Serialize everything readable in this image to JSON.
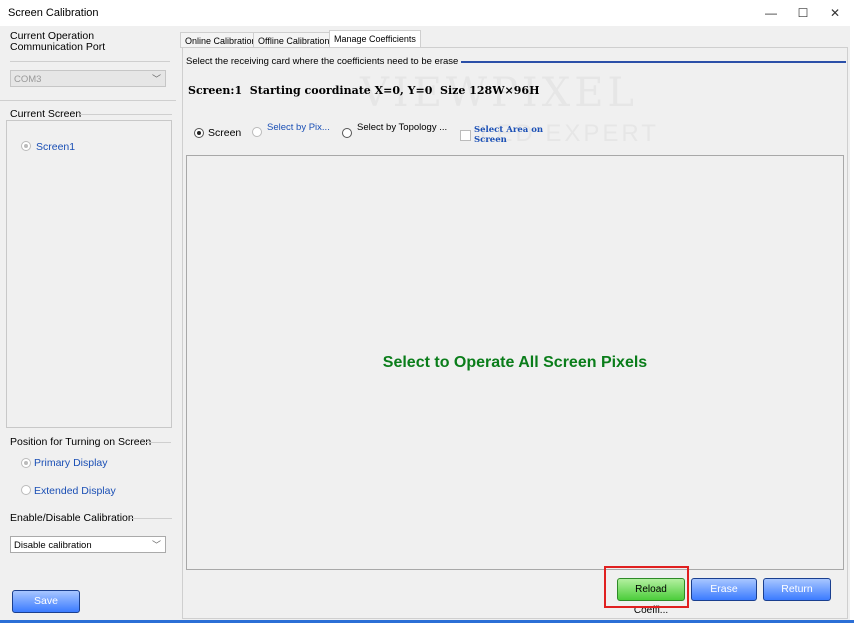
{
  "window": {
    "title": "Screen Calibration",
    "minimize": "—",
    "maximize": "☐",
    "close": "✕"
  },
  "left": {
    "comm_port_label": "Current Operation Communication Port",
    "comm_port_value": "COM3",
    "current_screen_label": "Current Screen",
    "screen_option": "Screen1",
    "position_label": "Position for Turning on Screen",
    "primary_display": "Primary Display",
    "extended_display": "Extended Display",
    "calibration_label": "Enable/Disable Calibration",
    "calibration_value": "Disable calibration",
    "save_button": "Save"
  },
  "tabs": [
    {
      "label": "Online Calibration",
      "active": false
    },
    {
      "label": "Offline Calibration",
      "active": false
    },
    {
      "label": "Manage Coefficients",
      "active": true
    }
  ],
  "main": {
    "instruction": "Select the receiving card where the coefficients need to be erase",
    "screen_info": "Screen:1  Starting coordinate X=0, Y=0  Size 128W×96H",
    "options": {
      "screen": "Screen",
      "select_by_pixel": "Select by Pix...",
      "select_by_topology": "Select by Topology ...",
      "select_area": "Select Area on Screen"
    },
    "area_message": "Select to Operate All Screen Pixels",
    "watermark_top": "VIEWPIXEL",
    "watermark_bottom": "LED EXPERT"
  },
  "buttons": {
    "reload": "Reload Coeffi...",
    "erase": "Erase",
    "return": "Return"
  },
  "colors": {
    "accent_blue": "#3b7bff",
    "green_button": "#4ccd3b",
    "message_green": "#0a7d1a",
    "highlight_red": "#e02020"
  }
}
